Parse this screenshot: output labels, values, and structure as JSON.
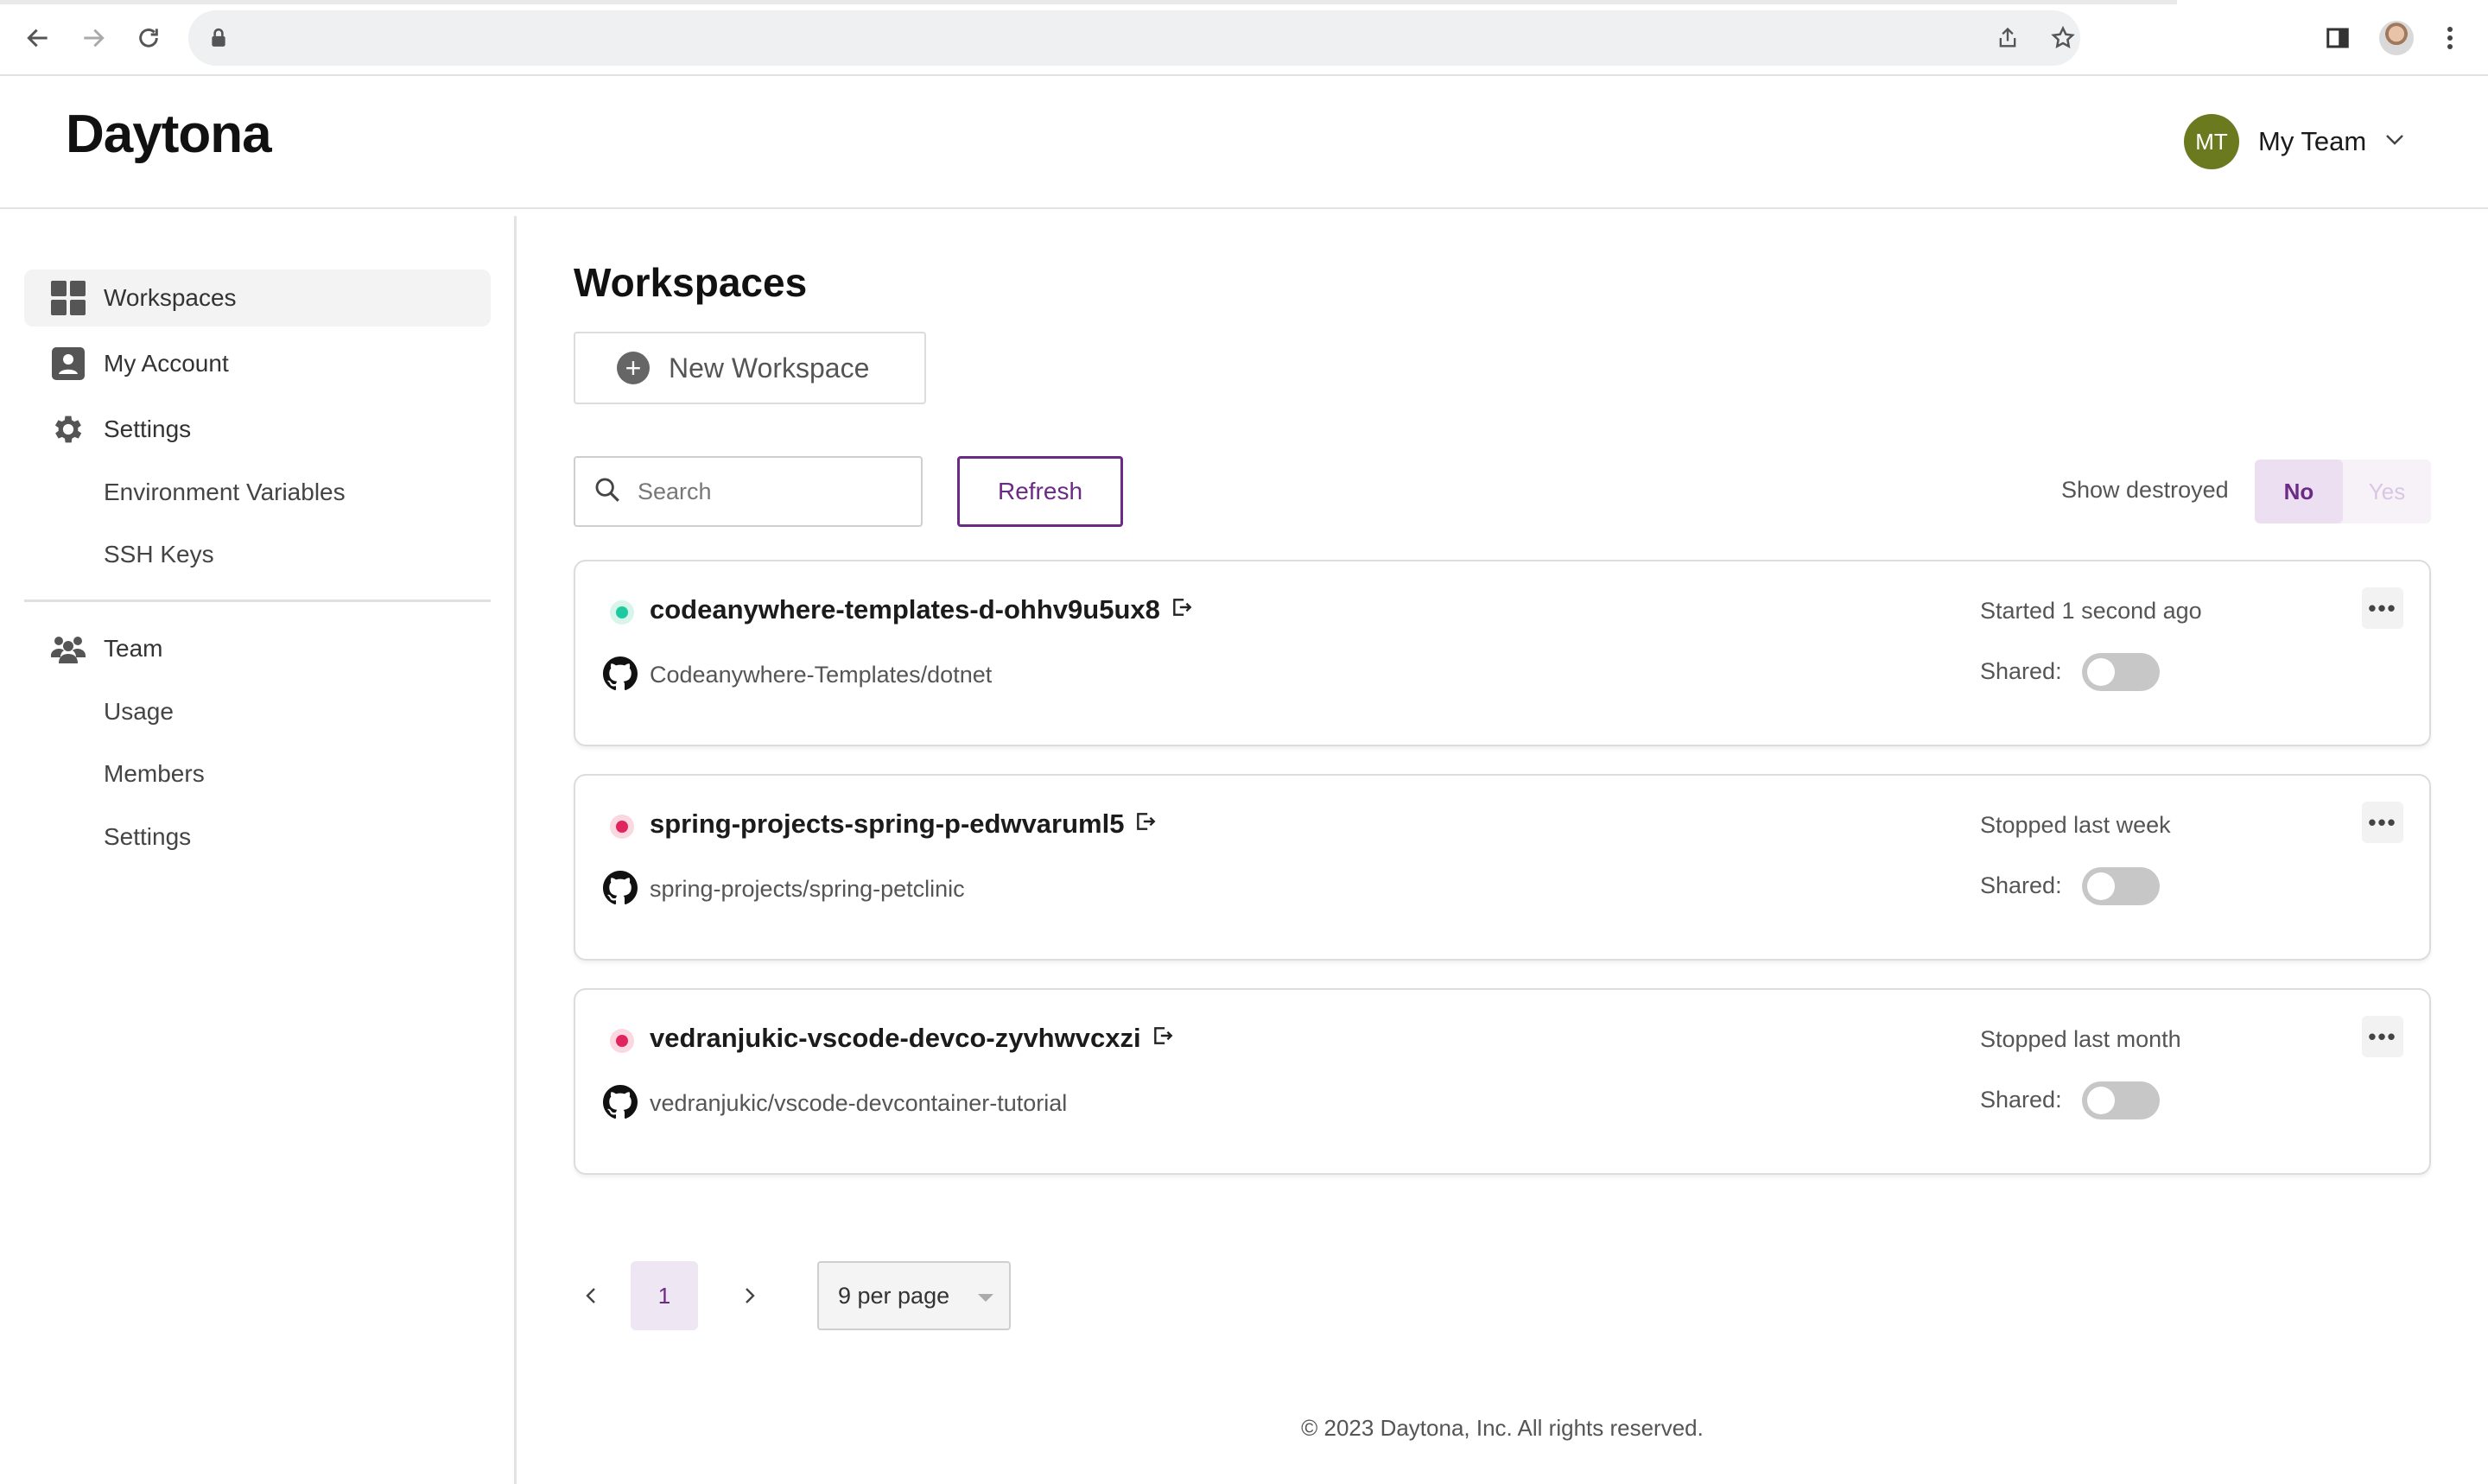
{
  "browser": {
    "url": "",
    "icons": [
      "back-icon",
      "forward-icon",
      "reload-icon",
      "lock-icon",
      "share-icon",
      "bookmark-star-icon",
      "side-panel-icon",
      "profile-avatar",
      "kebab-menu-icon"
    ]
  },
  "app": {
    "logo": "Daytona",
    "team": {
      "initials": "MT",
      "name": "My Team",
      "avatar_color": "#6b7a1f"
    }
  },
  "sidebar": {
    "items": [
      {
        "label": "Workspaces",
        "icon": "grid-icon",
        "active": true
      },
      {
        "label": "My Account",
        "icon": "account-icon",
        "active": false
      },
      {
        "label": "Settings",
        "icon": "gear-icon",
        "active": false
      }
    ],
    "settings_sub": [
      "Environment Variables",
      "SSH Keys"
    ],
    "team": {
      "label": "Team",
      "icon": "team-icon"
    },
    "team_sub": [
      "Usage",
      "Members",
      "Settings"
    ]
  },
  "main": {
    "title": "Workspaces",
    "new_workspace": "New Workspace",
    "search_placeholder": "Search",
    "refresh": "Refresh",
    "show_destroyed": {
      "label": "Show destroyed",
      "options": [
        "No",
        "Yes"
      ],
      "selected": "No"
    },
    "workspaces": [
      {
        "name": "codeanywhere-templates-d-ohhv9u5ux8",
        "repo": "Codeanywhere-Templates/dotnet",
        "status": "Started 1 second ago",
        "state": "running",
        "shared_label": "Shared:",
        "shared": false
      },
      {
        "name": "spring-projects-spring-p-edwvaruml5",
        "repo": "spring-projects/spring-petclinic",
        "status": "Stopped last week",
        "state": "stopped",
        "shared_label": "Shared:",
        "shared": false
      },
      {
        "name": "vedranjukic-vscode-devco-zyvhwvcxzi",
        "repo": "vedranjukic/vscode-devcontainer-tutorial",
        "status": "Stopped last month",
        "state": "stopped",
        "shared_label": "Shared:",
        "shared": false
      }
    ],
    "pagination": {
      "current_page": "1",
      "per_page": "9 per page"
    },
    "footer": "© 2023 Daytona, Inc. All rights reserved."
  },
  "colors": {
    "accent": "#6b2a86",
    "running": "#1fc9a0",
    "stopped": "#e0245e"
  }
}
